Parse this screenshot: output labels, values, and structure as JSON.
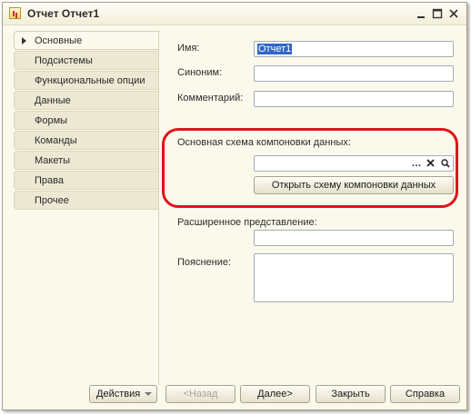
{
  "window": {
    "title": "Отчет Отчет1",
    "controls": [
      "minimize-icon",
      "maximize-icon",
      "close-icon"
    ]
  },
  "sidebar": {
    "items": [
      {
        "label": "Основные",
        "active": true
      },
      {
        "label": "Подсистемы",
        "active": false
      },
      {
        "label": "Функциональные опции",
        "active": false
      },
      {
        "label": "Данные",
        "active": false
      },
      {
        "label": "Формы",
        "active": false
      },
      {
        "label": "Команды",
        "active": false
      },
      {
        "label": "Макеты",
        "active": false
      },
      {
        "label": "Права",
        "active": false
      },
      {
        "label": "Прочее",
        "active": false
      }
    ]
  },
  "form": {
    "name_label": "Имя:",
    "name_value": "Отчет1",
    "synonym_label": "Синоним:",
    "synonym_value": "",
    "comment_label": "Комментарий:",
    "comment_value": "",
    "schema_label": "Основная схема компоновки данных:",
    "schema_value": "",
    "schema_pick_icon": "ellipsis-icon",
    "schema_clear_icon": "clear-x-icon",
    "schema_open_icon": "magnifier-icon",
    "open_schema_button": "Открыть схему компоновки данных",
    "extended_label": "Расширенное представление:",
    "extended_value": "",
    "explanation_label": "Пояснение:",
    "explanation_value": ""
  },
  "footer": {
    "actions": "Действия",
    "back": "<Назад",
    "next": "Далее>",
    "close": "Закрыть",
    "help": "Справка"
  },
  "colors": {
    "window_bg": "#fbf9ec",
    "highlight": "#e2121b",
    "selection": "#3166c4"
  }
}
